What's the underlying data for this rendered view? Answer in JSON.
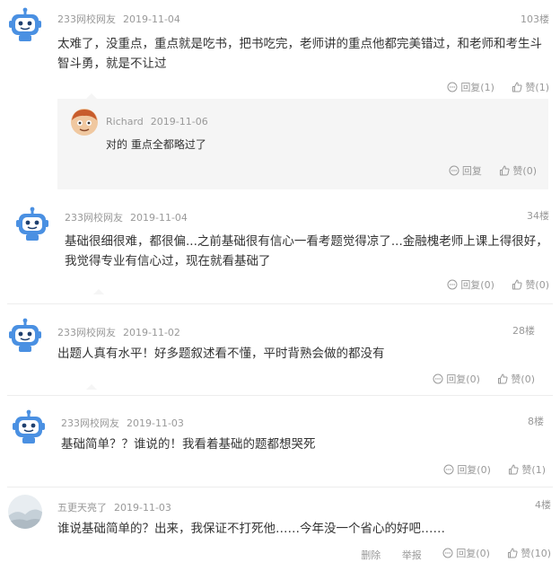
{
  "comments": [
    {
      "user": "233网校网友",
      "date": "2019-11-04",
      "floor": "103楼",
      "text": "太难了，没重点，重点就是吃书，把书吃完，老师讲的重点他都完美错过，和老师和考生斗智斗勇，就是不让过",
      "reply_label": "回复(1)",
      "like_label": "赞(1)",
      "reply": {
        "user": "Richard",
        "date": "2019-11-06",
        "text": "对的 重点全都略过了",
        "reply_label": "回复",
        "like_label": "赞(0)"
      }
    },
    {
      "user": "233网校网友",
      "date": "2019-11-04",
      "floor": "34楼",
      "text": "基础很细很难，都很偏...之前基础很有信心一看考题觉得凉了...金融槐老师上课上得很好，我觉得专业有信心过，现在就看基础了",
      "reply_label": "回复(0)",
      "like_label": "赞(0)"
    },
    {
      "user": "233网校网友",
      "date": "2019-11-02",
      "floor": "28楼",
      "text": "出题人真有水平！好多题叙述看不懂，平时背熟会做的都没有",
      "reply_label": "回复(0)",
      "like_label": "赞(0)"
    },
    {
      "user": "233网校网友",
      "date": "2019-11-03",
      "floor": "8楼",
      "text": "基础简单？？谁说的！我看着基础的题都想哭死",
      "reply_label": "回复(0)",
      "like_label": "赞(1)"
    },
    {
      "user": "五更天亮了",
      "date": "2019-11-03",
      "floor": "4楼",
      "text": "谁说基础简单的？出来，我保证不打死他……今年没一个省心的好吧……",
      "delete_label": "删除",
      "report_label": "举报",
      "reply_label": "回复(0)",
      "like_label": "赞(10)"
    }
  ],
  "icons": {
    "avatar": "robot-avatar-icon",
    "reply": "speech-bubble-icon",
    "like": "thumbs-up-icon",
    "reply_avatar": "cartoon-face-avatar",
    "user5_avatar": "landscape-avatar"
  },
  "colors": {
    "accent": "#4a90e2",
    "text": "#333333",
    "meta": "#999999",
    "reply_bg": "#f5f5f5"
  }
}
